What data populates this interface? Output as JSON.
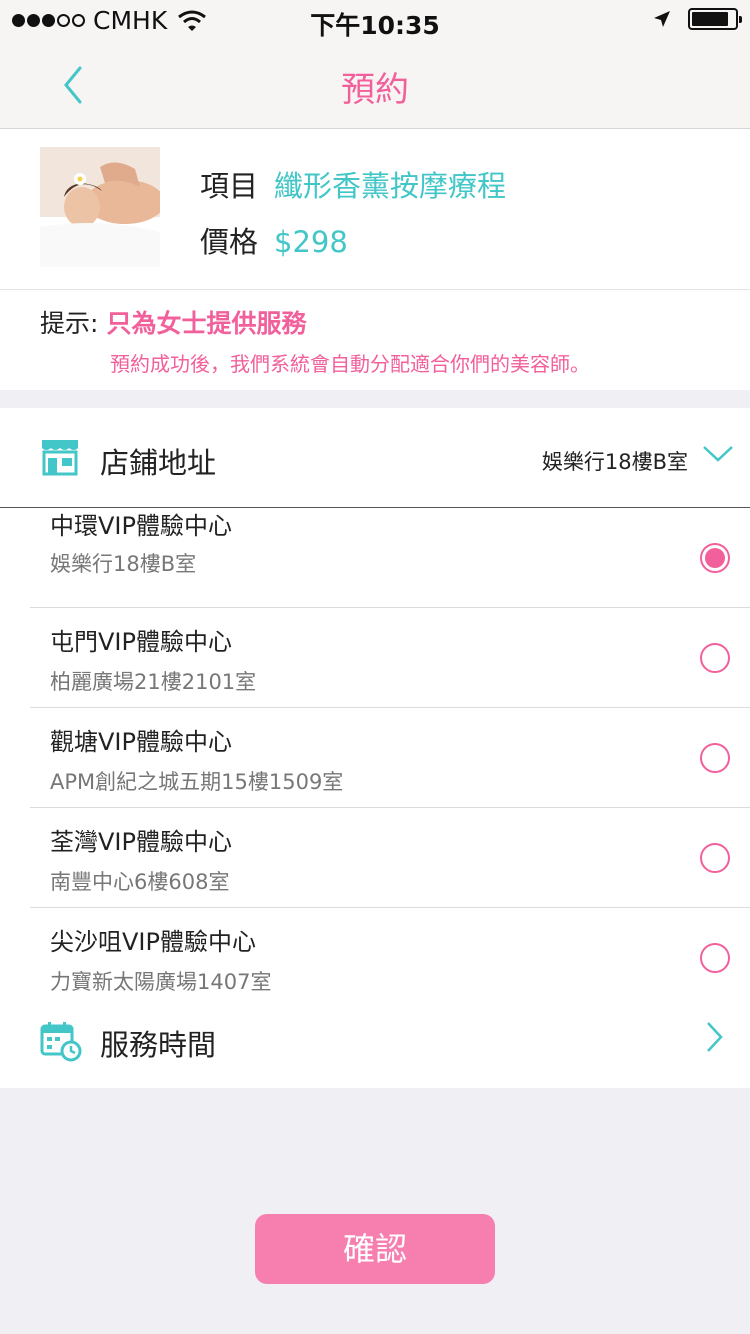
{
  "status_bar": {
    "carrier": "CMHK",
    "time": "下午10:35",
    "signal_bars": 3,
    "battery_level": 0.85
  },
  "nav": {
    "title": "預約"
  },
  "product": {
    "item_label": "項目",
    "item_value": "纖形香薰按摩療程",
    "price_label": "價格",
    "price_value": "$298"
  },
  "tip": {
    "label": "提示:",
    "value": "只為女士提供服務",
    "note": "預約成功後，我們系統會自動分配適合你們的美容師。"
  },
  "store": {
    "title": "店鋪地址",
    "selected": "娛樂行18樓B室",
    "options": [
      {
        "name": "中環VIP體驗中心",
        "address": "娛樂行18樓B室",
        "checked": true
      },
      {
        "name": "屯門VIP體驗中心",
        "address": "柏麗廣場21樓2101室",
        "checked": false
      },
      {
        "name": "觀塘VIP體驗中心",
        "address": "APM創紀之城五期15樓1509室",
        "checked": false
      },
      {
        "name": "荃灣VIP體驗中心",
        "address": "南豐中心6樓608室",
        "checked": false
      },
      {
        "name": "尖沙咀VIP體驗中心",
        "address": "力寶新太陽廣場1407室",
        "checked": false
      }
    ]
  },
  "service_time": {
    "title": "服務時間"
  },
  "confirm_label": "確認",
  "colors": {
    "accent_pink": "#f2609c",
    "teal": "#42c6c8",
    "button_pink": "#f77fb0"
  }
}
